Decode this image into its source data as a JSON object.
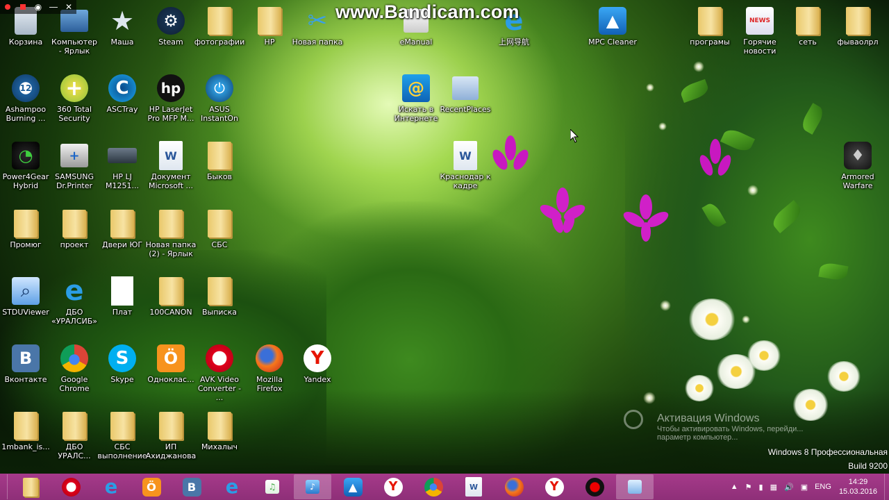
{
  "recorder": {
    "watermark": "www.Bandicam.com"
  },
  "desktop_icons": [
    {
      "label": "Корзина",
      "icon": "recycle-bin-icon"
    },
    {
      "label": "Компьютер\n- Ярлык",
      "icon": "computer-icon"
    },
    {
      "label": "Маша",
      "icon": "star-icon"
    },
    {
      "label": "Steam",
      "icon": "steam-icon"
    },
    {
      "label": "фотографии",
      "icon": "folder-icon"
    },
    {
      "label": "HP",
      "icon": "folder-icon"
    },
    {
      "label": "Новая папка",
      "icon": "scissors-icon"
    },
    {
      "label": "eManual",
      "icon": "emanual-icon"
    },
    {
      "label": "上网导航",
      "icon": "ie-icon"
    },
    {
      "label": "MPC Cleaner",
      "icon": "mpc-cleaner-icon"
    },
    {
      "label": "програмы",
      "icon": "folder-icon"
    },
    {
      "label": "Горячие\nновости",
      "icon": "news-icon"
    },
    {
      "label": "сеть",
      "icon": "folder-icon"
    },
    {
      "label": "фываолрл",
      "icon": "folder-icon"
    },
    {
      "label": "Ashampoo\nBurning ...",
      "icon": "ashampoo-icon"
    },
    {
      "label": "360 Total\nSecurity",
      "icon": "360-security-icon"
    },
    {
      "label": "ASCTray",
      "icon": "asctray-icon"
    },
    {
      "label": "HP LaserJet\nPro MFP M...",
      "icon": "hp-icon"
    },
    {
      "label": "ASUS\nInstantOn",
      "icon": "asus-instanton-icon"
    },
    {
      "label": "Искать в\nИнтернете",
      "icon": "mail-search-icon"
    },
    {
      "label": "RecentPlaces",
      "icon": "recent-places-icon"
    },
    {
      "label": "Power4Gear\nHybrid",
      "icon": "power4gear-icon"
    },
    {
      "label": "SAMSUNG\nDr.Printer",
      "icon": "samsung-printer-icon"
    },
    {
      "label": "HP LJ\nM1251...",
      "icon": "scanner-icon"
    },
    {
      "label": "Документ\nMicrosoft ...",
      "icon": "document-icon"
    },
    {
      "label": "Быков",
      "icon": "folder-icon"
    },
    {
      "label": "Краснодар к\nкадре",
      "icon": "document-icon"
    },
    {
      "label": "Armored\nWarfare",
      "icon": "armored-warfare-icon"
    },
    {
      "label": "Промюг",
      "icon": "folder-icon"
    },
    {
      "label": "проект",
      "icon": "folder-icon"
    },
    {
      "label": "Двери ЮГ",
      "icon": "folder-icon"
    },
    {
      "label": "Новая папка\n(2) - Ярлык",
      "icon": "folder-icon"
    },
    {
      "label": "СБС",
      "icon": "folder-icon"
    },
    {
      "label": "STDUViewer",
      "icon": "stduviewer-icon"
    },
    {
      "label": "ДБО\n«УРАЛСИБ»",
      "icon": "ie-icon"
    },
    {
      "label": "Плат",
      "icon": "blank-file-icon"
    },
    {
      "label": "100CANON",
      "icon": "folder-icon"
    },
    {
      "label": "Выписка",
      "icon": "folder-icon"
    },
    {
      "label": "Вконтакте",
      "icon": "vk-icon"
    },
    {
      "label": "Google\nChrome",
      "icon": "chrome-icon"
    },
    {
      "label": "Skype",
      "icon": "skype-icon"
    },
    {
      "label": "Одноклас...",
      "icon": "odnoklassniki-icon"
    },
    {
      "label": "AVK Video\nConverter - ...",
      "icon": "opera-icon"
    },
    {
      "label": "Mozilla\nFirefox",
      "icon": "firefox-icon"
    },
    {
      "label": "Yandex",
      "icon": "yandex-icon"
    },
    {
      "label": "1mbank_is...",
      "icon": "folder-icon"
    },
    {
      "label": "ДБО\nУРАЛС...",
      "icon": "folder-icon"
    },
    {
      "label": "СБС\nвыполнение",
      "icon": "folder-icon"
    },
    {
      "label": "ИП\nАхиджанова",
      "icon": "folder-icon"
    },
    {
      "label": "Михалыч",
      "icon": "folder-icon"
    }
  ],
  "activation": {
    "line1": "Активация Windows",
    "line2": "Чтобы активировать Windows, перейди...",
    "line3": "параметр компьютер..."
  },
  "windows_version": {
    "line1": "Windows 8 Профессиональная",
    "line2": "Build 9200"
  },
  "taskbar": {
    "items": [
      {
        "icon": "file-explorer-icon"
      },
      {
        "icon": "opera-icon"
      },
      {
        "icon": "ie-icon"
      },
      {
        "icon": "odnoklassniki-icon"
      },
      {
        "icon": "vk-icon"
      },
      {
        "icon": "ie-icon"
      },
      {
        "icon": "music-icon"
      },
      {
        "icon": "audio-icon"
      },
      {
        "icon": "mpc-cleaner-icon"
      },
      {
        "icon": "yandex-icon"
      },
      {
        "icon": "chrome-icon"
      },
      {
        "icon": "document-icon"
      },
      {
        "icon": "firefox-icon"
      },
      {
        "icon": "yandex-icon"
      },
      {
        "icon": "bandicam-record-icon"
      },
      {
        "icon": "control-panel-icon"
      }
    ],
    "tray": {
      "language": "ENG",
      "time": "14:29",
      "date": "15.03.2016"
    }
  },
  "colors": {
    "taskbar": "#9a3480",
    "accent_green": "#5da82a"
  }
}
